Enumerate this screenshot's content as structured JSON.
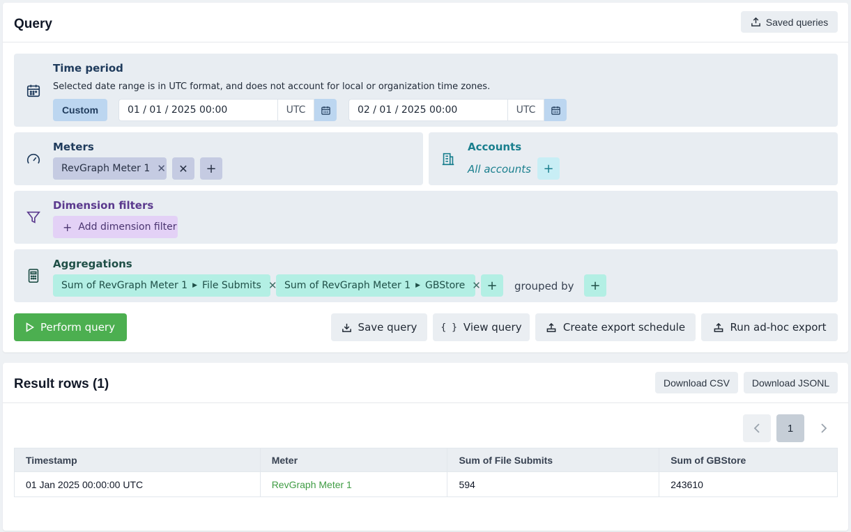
{
  "query_card": {
    "title": "Query",
    "saved_queries_label": "Saved queries"
  },
  "time_period": {
    "title": "Time period",
    "description": "Selected date range is in UTC format, and does not account for local or organization time zones.",
    "range_type": "Custom",
    "start_value": "01 / 01 / 2025 00:00",
    "start_tz": "UTC",
    "end_value": "02 / 01 / 2025 00:00",
    "end_tz": "UTC"
  },
  "meters": {
    "title": "Meters",
    "chips": [
      "RevGraph Meter 1"
    ]
  },
  "accounts": {
    "title": "Accounts",
    "value": "All accounts"
  },
  "dimension_filters": {
    "title": "Dimension filters",
    "add_label": "Add dimension filter"
  },
  "aggregations": {
    "title": "Aggregations",
    "chips": [
      {
        "prefix": "Sum of RevGraph Meter 1",
        "suffix": "File Submits"
      },
      {
        "prefix": "Sum of RevGraph Meter 1",
        "suffix": "GBStore"
      }
    ],
    "grouped_by_label": "grouped by"
  },
  "actions": {
    "perform": "Perform query",
    "save": "Save query",
    "view": "View query",
    "schedule": "Create export schedule",
    "adhoc": "Run ad-hoc export"
  },
  "results": {
    "title": "Result rows (1)",
    "download_csv": "Download CSV",
    "download_jsonl": "Download JSONL",
    "current_page": "1",
    "columns": [
      "Timestamp",
      "Meter",
      "Sum of File Submits",
      "Sum of GBStore"
    ],
    "rows": [
      [
        "01 Jan 2025 00:00:00 UTC",
        "RevGraph Meter 1",
        "594",
        "243610"
      ]
    ]
  },
  "colors": {
    "time_title": "#1f3b5c",
    "meters_title": "#1f3b5c",
    "accounts_title": "#1a7f8e",
    "dimension_title": "#5b3a8e",
    "aggregations_title": "#1f4f47",
    "perform_button": "#4caf50",
    "link_green": "#3f9c44"
  },
  "icons": {
    "saved_queries": "upload-icon",
    "time": "calendar-icon",
    "meters": "gauge-icon",
    "accounts": "building-icon",
    "dimension": "funnel-icon",
    "aggregations": "calculator-icon"
  }
}
